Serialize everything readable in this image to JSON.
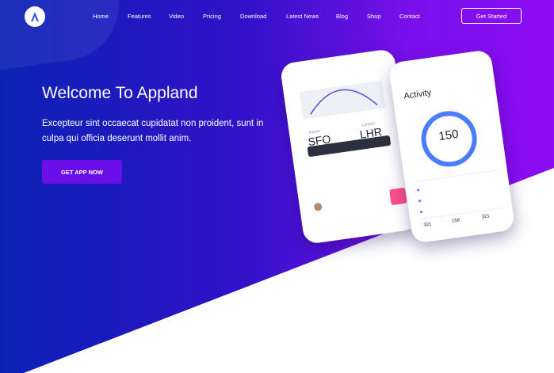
{
  "nav": {
    "items": [
      "Home",
      "Features",
      "Video",
      "Pricing",
      "Download",
      "Latest News",
      "Blog",
      "Shop",
      "Contact"
    ],
    "cta": "Get Started"
  },
  "hero": {
    "title": "Welcome To Appland",
    "subtitle": "Excepteur sint occaecat cupidatat non proident, sunt in culpa qui officia deserunt mollit anim.",
    "cta": "GET APP NOW"
  },
  "phone_ticket": {
    "from": "SFO",
    "to": "LHR",
    "cities": [
      "Rome",
      "London"
    ]
  },
  "phone_activity": {
    "title": "Activity",
    "ring_value": "150",
    "stats": [
      "321",
      "158",
      "321"
    ]
  },
  "colors": {
    "gradient_start": "#0a22b4",
    "gradient_end": "#8d0cf2",
    "button": "#6b0fe8",
    "accent_blue": "#4a7cff",
    "qr_pink": "#ff4f8c"
  }
}
